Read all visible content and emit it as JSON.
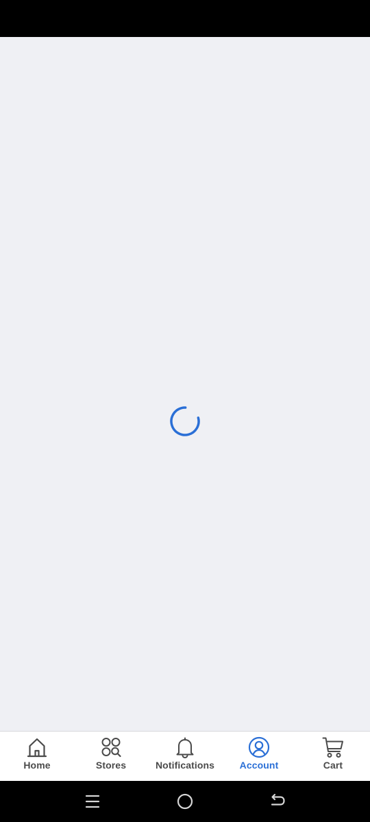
{
  "bottom_nav": {
    "items": [
      {
        "label": "Home",
        "icon": "home-icon",
        "active": false
      },
      {
        "label": "Stores",
        "icon": "stores-icon",
        "active": false
      },
      {
        "label": "Notifications",
        "icon": "bell-icon",
        "active": false
      },
      {
        "label": "Account",
        "icon": "account-icon",
        "active": true
      },
      {
        "label": "Cart",
        "icon": "cart-icon",
        "active": false
      }
    ]
  },
  "system_nav": {
    "buttons": [
      "recents-icon",
      "home-circle-icon",
      "back-icon"
    ]
  },
  "colors": {
    "accent": "#2a6fd6",
    "content_background": "#eff0f4",
    "nav_label": "#4a4a4a",
    "icon_stroke": "#4a4a4a"
  }
}
